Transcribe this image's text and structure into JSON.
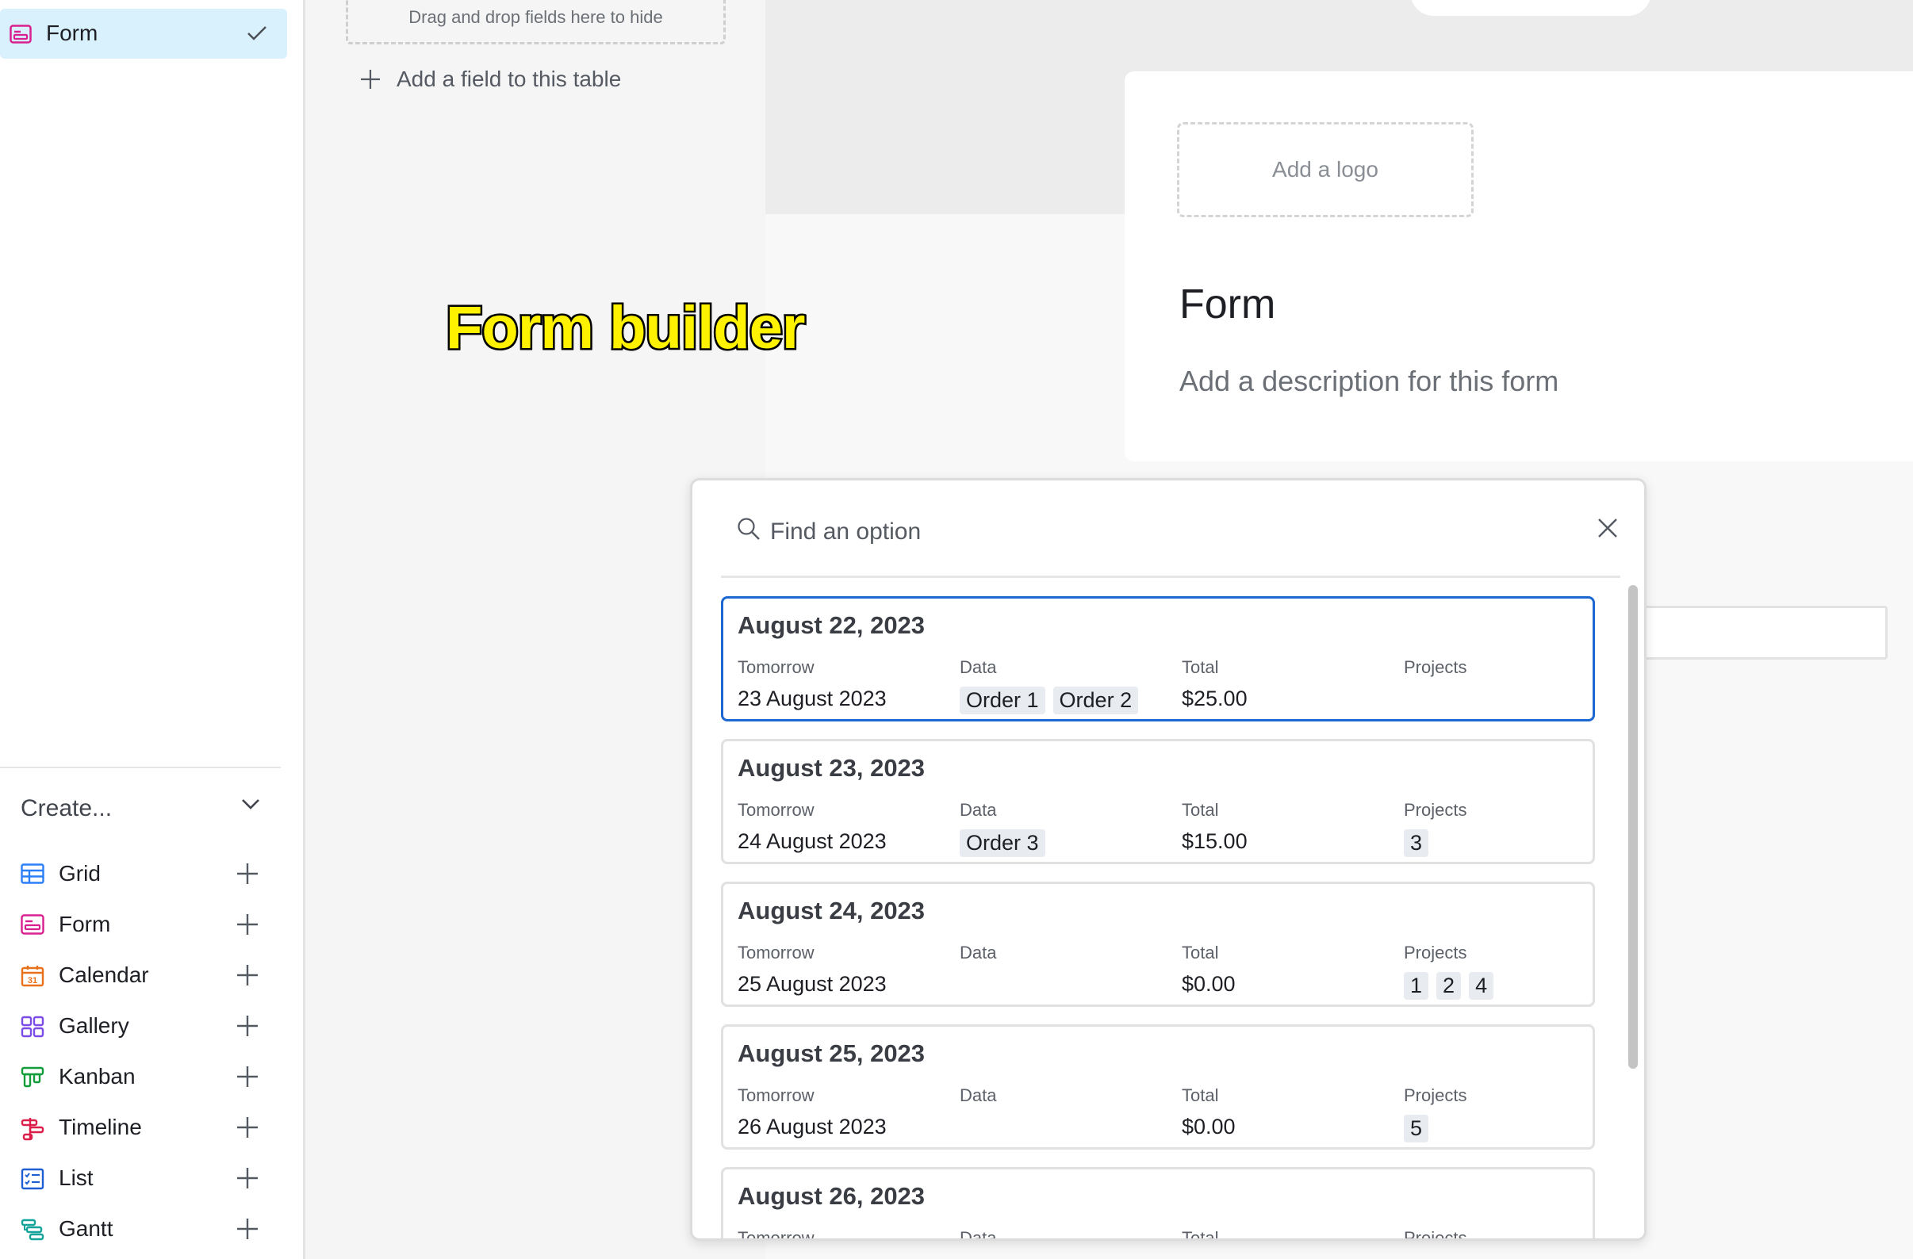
{
  "sidebar": {
    "active_view": {
      "label": "Form",
      "icon": "form-icon",
      "selected_icon": "checkmark-icon"
    },
    "create": {
      "label": "Create...",
      "items": [
        {
          "label": "Grid",
          "icon": "grid-icon",
          "color": "#2d7ff9"
        },
        {
          "label": "Form",
          "icon": "form-icon",
          "color": "#d9208f"
        },
        {
          "label": "Calendar",
          "icon": "calendar-icon",
          "color": "#e8711b"
        },
        {
          "label": "Gallery",
          "icon": "gallery-icon",
          "color": "#7b4ce8"
        },
        {
          "label": "Kanban",
          "icon": "kanban-icon",
          "color": "#139c3a"
        },
        {
          "label": "Timeline",
          "icon": "timeline-icon",
          "color": "#dc1f4a"
        },
        {
          "label": "List",
          "icon": "list-icon",
          "color": "#1f5fd1"
        },
        {
          "label": "Gantt",
          "icon": "gantt-icon",
          "color": "#16a39a"
        }
      ]
    }
  },
  "fields_panel": {
    "drop_zone_text": "Drag and drop fields here to hide",
    "add_field_label": "Add a field to this table"
  },
  "form": {
    "logo_placeholder": "Add a logo",
    "title": "Form",
    "description_placeholder": "Add a description for this form"
  },
  "annotation": "Form builder",
  "picker": {
    "search_placeholder": "Find an option",
    "columns": [
      "Tomorrow",
      "Data",
      "Total",
      "Projects"
    ],
    "records": [
      {
        "title": "August 22, 2023",
        "tomorrow": "23 August 2023",
        "data": [
          "Order 1",
          "Order 2"
        ],
        "total": "$25.00",
        "projects": []
      },
      {
        "title": "August 23, 2023",
        "tomorrow": "24 August 2023",
        "data": [
          "Order 3"
        ],
        "total": "$15.00",
        "projects": [
          "3"
        ]
      },
      {
        "title": "August 24, 2023",
        "tomorrow": "25 August 2023",
        "data": [],
        "total": "$0.00",
        "projects": [
          "1",
          "2",
          "4"
        ]
      },
      {
        "title": "August 25, 2023",
        "tomorrow": "26 August 2023",
        "data": [],
        "total": "$0.00",
        "projects": [
          "5"
        ]
      },
      {
        "title": "August 26, 2023",
        "tomorrow": "",
        "data": [],
        "total": "",
        "projects": []
      }
    ]
  },
  "colors": {
    "selected_view_bg": "#d9f1fd",
    "selected_record_border": "#1d68d0",
    "annotation_fill": "#fff200"
  }
}
